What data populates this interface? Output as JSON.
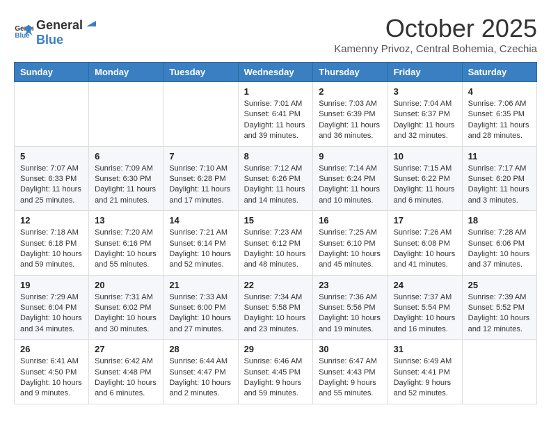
{
  "header": {
    "logo_general": "General",
    "logo_blue": "Blue",
    "month": "October 2025",
    "location": "Kamenny Privoz, Central Bohemia, Czechia"
  },
  "days_of_week": [
    "Sunday",
    "Monday",
    "Tuesday",
    "Wednesday",
    "Thursday",
    "Friday",
    "Saturday"
  ],
  "weeks": [
    [
      {
        "day": "",
        "info": ""
      },
      {
        "day": "",
        "info": ""
      },
      {
        "day": "",
        "info": ""
      },
      {
        "day": "1",
        "info": "Sunrise: 7:01 AM\nSunset: 6:41 PM\nDaylight: 11 hours\nand 39 minutes."
      },
      {
        "day": "2",
        "info": "Sunrise: 7:03 AM\nSunset: 6:39 PM\nDaylight: 11 hours\nand 36 minutes."
      },
      {
        "day": "3",
        "info": "Sunrise: 7:04 AM\nSunset: 6:37 PM\nDaylight: 11 hours\nand 32 minutes."
      },
      {
        "day": "4",
        "info": "Sunrise: 7:06 AM\nSunset: 6:35 PM\nDaylight: 11 hours\nand 28 minutes."
      }
    ],
    [
      {
        "day": "5",
        "info": "Sunrise: 7:07 AM\nSunset: 6:33 PM\nDaylight: 11 hours\nand 25 minutes."
      },
      {
        "day": "6",
        "info": "Sunrise: 7:09 AM\nSunset: 6:30 PM\nDaylight: 11 hours\nand 21 minutes."
      },
      {
        "day": "7",
        "info": "Sunrise: 7:10 AM\nSunset: 6:28 PM\nDaylight: 11 hours\nand 17 minutes."
      },
      {
        "day": "8",
        "info": "Sunrise: 7:12 AM\nSunset: 6:26 PM\nDaylight: 11 hours\nand 14 minutes."
      },
      {
        "day": "9",
        "info": "Sunrise: 7:14 AM\nSunset: 6:24 PM\nDaylight: 11 hours\nand 10 minutes."
      },
      {
        "day": "10",
        "info": "Sunrise: 7:15 AM\nSunset: 6:22 PM\nDaylight: 11 hours\nand 6 minutes."
      },
      {
        "day": "11",
        "info": "Sunrise: 7:17 AM\nSunset: 6:20 PM\nDaylight: 11 hours\nand 3 minutes."
      }
    ],
    [
      {
        "day": "12",
        "info": "Sunrise: 7:18 AM\nSunset: 6:18 PM\nDaylight: 10 hours\nand 59 minutes."
      },
      {
        "day": "13",
        "info": "Sunrise: 7:20 AM\nSunset: 6:16 PM\nDaylight: 10 hours\nand 55 minutes."
      },
      {
        "day": "14",
        "info": "Sunrise: 7:21 AM\nSunset: 6:14 PM\nDaylight: 10 hours\nand 52 minutes."
      },
      {
        "day": "15",
        "info": "Sunrise: 7:23 AM\nSunset: 6:12 PM\nDaylight: 10 hours\nand 48 minutes."
      },
      {
        "day": "16",
        "info": "Sunrise: 7:25 AM\nSunset: 6:10 PM\nDaylight: 10 hours\nand 45 minutes."
      },
      {
        "day": "17",
        "info": "Sunrise: 7:26 AM\nSunset: 6:08 PM\nDaylight: 10 hours\nand 41 minutes."
      },
      {
        "day": "18",
        "info": "Sunrise: 7:28 AM\nSunset: 6:06 PM\nDaylight: 10 hours\nand 37 minutes."
      }
    ],
    [
      {
        "day": "19",
        "info": "Sunrise: 7:29 AM\nSunset: 6:04 PM\nDaylight: 10 hours\nand 34 minutes."
      },
      {
        "day": "20",
        "info": "Sunrise: 7:31 AM\nSunset: 6:02 PM\nDaylight: 10 hours\nand 30 minutes."
      },
      {
        "day": "21",
        "info": "Sunrise: 7:33 AM\nSunset: 6:00 PM\nDaylight: 10 hours\nand 27 minutes."
      },
      {
        "day": "22",
        "info": "Sunrise: 7:34 AM\nSunset: 5:58 PM\nDaylight: 10 hours\nand 23 minutes."
      },
      {
        "day": "23",
        "info": "Sunrise: 7:36 AM\nSunset: 5:56 PM\nDaylight: 10 hours\nand 19 minutes."
      },
      {
        "day": "24",
        "info": "Sunrise: 7:37 AM\nSunset: 5:54 PM\nDaylight: 10 hours\nand 16 minutes."
      },
      {
        "day": "25",
        "info": "Sunrise: 7:39 AM\nSunset: 5:52 PM\nDaylight: 10 hours\nand 12 minutes."
      }
    ],
    [
      {
        "day": "26",
        "info": "Sunrise: 6:41 AM\nSunset: 4:50 PM\nDaylight: 10 hours\nand 9 minutes."
      },
      {
        "day": "27",
        "info": "Sunrise: 6:42 AM\nSunset: 4:48 PM\nDaylight: 10 hours\nand 6 minutes."
      },
      {
        "day": "28",
        "info": "Sunrise: 6:44 AM\nSunset: 4:47 PM\nDaylight: 10 hours\nand 2 minutes."
      },
      {
        "day": "29",
        "info": "Sunrise: 6:46 AM\nSunset: 4:45 PM\nDaylight: 9 hours\nand 59 minutes."
      },
      {
        "day": "30",
        "info": "Sunrise: 6:47 AM\nSunset: 4:43 PM\nDaylight: 9 hours\nand 55 minutes."
      },
      {
        "day": "31",
        "info": "Sunrise: 6:49 AM\nSunset: 4:41 PM\nDaylight: 9 hours\nand 52 minutes."
      },
      {
        "day": "",
        "info": ""
      }
    ]
  ]
}
